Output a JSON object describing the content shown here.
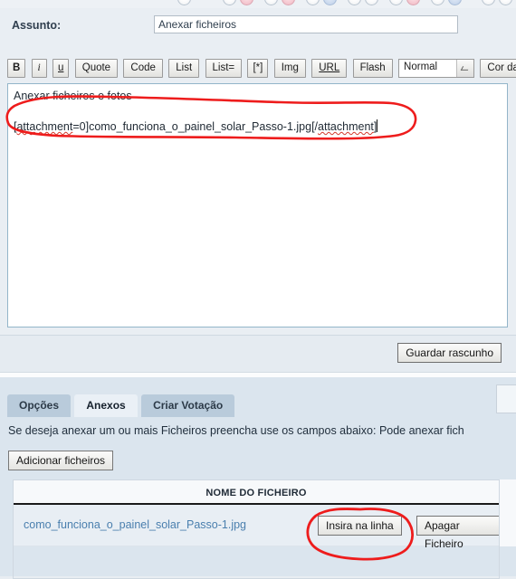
{
  "emoticons": {
    "count": 13,
    "description": "cut-off emoticon picker row"
  },
  "composer": {
    "subject": {
      "label": "Assunto:",
      "value": "Anexar ficheiros",
      "placeholder": ""
    },
    "toolbar": {
      "buttons": [
        {
          "label": "B",
          "name": "bold-button",
          "style": "bold"
        },
        {
          "label": "i",
          "name": "italic-button",
          "style": "italic"
        },
        {
          "label": "u",
          "name": "underline-button",
          "style": "underline"
        },
        {
          "label": "Quote",
          "name": "quote-button",
          "style": "normal"
        },
        {
          "label": "Code",
          "name": "code-button",
          "style": "normal"
        },
        {
          "label": "List",
          "name": "list-button",
          "style": "normal"
        },
        {
          "label": "List=",
          "name": "ordered-list-button",
          "style": "normal"
        },
        {
          "label": "[*]",
          "name": "list-item-button",
          "style": "normal"
        },
        {
          "label": "Img",
          "name": "image-button",
          "style": "normal"
        },
        {
          "label": "URL",
          "name": "url-button",
          "style": "underline"
        },
        {
          "label": "Flash",
          "name": "flash-button",
          "style": "normal"
        }
      ],
      "font_size_select": {
        "value": "Normal",
        "options": [
          "Normal"
        ]
      },
      "color_label": "Cor da"
    },
    "message": {
      "line1": "Anexar ficheiros e fotos",
      "line2_prefix": "[",
      "line2_tag_open": "attachment",
      "line2_tag_open_rest": "=0]",
      "line2_filename": "como_funciona_o_painel_solar_Passo-1.jpg",
      "line2_close_prefix": "[/",
      "line2_tag_close": "attachment",
      "line2_close_suffix": "]",
      "full_line2": "[attachment=0]como_funciona_o_painel_solar_Passo-1.jpg[/attachment]"
    },
    "save_draft_label": "Guardar rascunho"
  },
  "attachments": {
    "tabs": [
      {
        "label": "Opções",
        "name": "tab-opcoes",
        "active": false
      },
      {
        "label": "Anexos",
        "name": "tab-anexos",
        "active": true
      },
      {
        "label": "Criar Votação",
        "name": "tab-criar-votacao",
        "active": false
      }
    ],
    "help_text": "Se deseja anexar um ou mais Ficheiros preencha use os campos abaixo: Pode anexar fich",
    "add_files_label": "Adicionar ficheiros",
    "table": {
      "header": "NOME DO FICHEIRO",
      "rows": [
        {
          "filename": "como_funciona_o_painel_solar_Passo-1.jpg",
          "insert_label": "Insira na linha",
          "delete_label": "Apagar Ficheiro"
        }
      ]
    }
  },
  "annotations": {
    "color": "#ee1c1c",
    "shapes": [
      {
        "name": "circle-around-attachment-bbcode",
        "target": "message-line-2"
      },
      {
        "name": "circle-around-insert-inline-button",
        "target": "insert-inline-button"
      }
    ]
  },
  "colors": {
    "page_background": "#e8edf2",
    "panel_background": "#e9eef3",
    "lower_panel_background": "#dbe5ee",
    "tab_inactive": "#b9cbdb",
    "tab_active": "#eaf0f6",
    "textarea_border": "#93b5c9",
    "link": "#4a7fae",
    "annotation_red": "#ee1c1c",
    "spellcheck_red": "#d23a2c"
  }
}
